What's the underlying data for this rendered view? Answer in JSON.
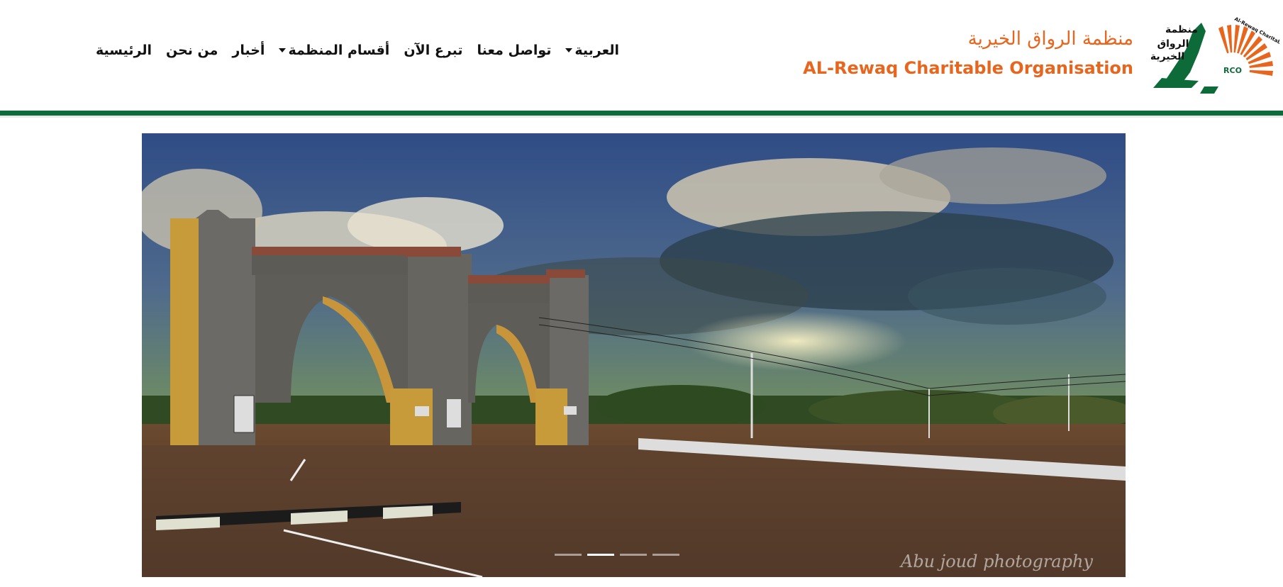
{
  "header": {
    "org_name_ar": "منظمة الرواق الخيرية",
    "org_name_en": "AL-Rewaq Charitable Organisation",
    "logo": {
      "text_ar_lines": [
        "منظمة",
        "الرواق",
        "الخيرية"
      ],
      "arc_text": "Al-Rewaq Charitable Organisation",
      "badge": "RCO"
    }
  },
  "nav": {
    "items": [
      {
        "label": "الرئيسية",
        "dropdown": false
      },
      {
        "label": "من نحن",
        "dropdown": false
      },
      {
        "label": "أخبار",
        "dropdown": false
      },
      {
        "label": "أقسام المنظمة",
        "dropdown": true
      },
      {
        "label": "تبرع الآن",
        "dropdown": false
      },
      {
        "label": "تواصل معنا",
        "dropdown": false
      },
      {
        "label": "العربية",
        "dropdown": true
      }
    ]
  },
  "carousel": {
    "watermark": "Abu joud photography",
    "slide_count": 4,
    "active_index": 1
  },
  "colors": {
    "brand_orange": "#e8651d",
    "brand_green": "#0d6b3a"
  }
}
